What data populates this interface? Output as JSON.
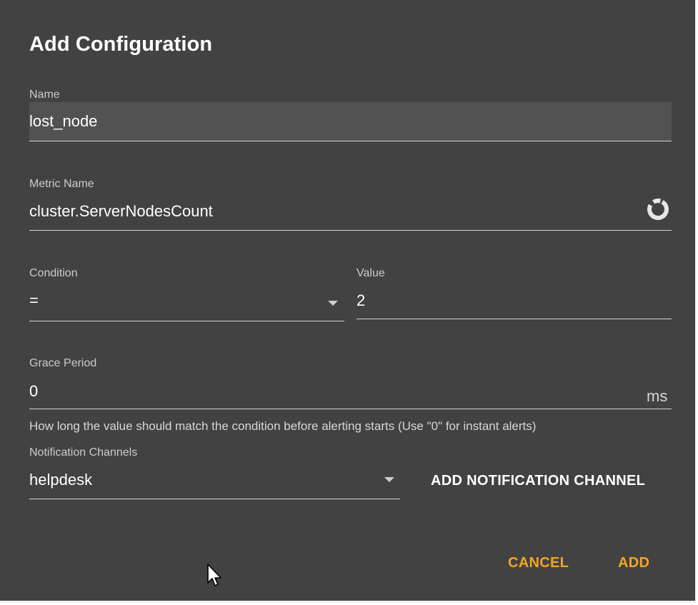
{
  "dialog": {
    "title": "Add Configuration"
  },
  "fields": {
    "name": {
      "label": "Name",
      "value": "lost_node"
    },
    "metric_name": {
      "label": "Metric Name",
      "value": "cluster.ServerNodesCount"
    },
    "condition": {
      "label": "Condition",
      "value": "="
    },
    "value": {
      "label": "Value",
      "value": "2"
    },
    "grace_period": {
      "label": "Grace Period",
      "value": "0",
      "suffix": "ms",
      "helper": "How long the value should match the condition before alerting starts (Use \"0\" for instant alerts)"
    },
    "notification_channels": {
      "label": "Notification Channels",
      "value": "helpdesk"
    }
  },
  "buttons": {
    "add_channel": "ADD NOTIFICATION CHANNEL",
    "cancel": "CANCEL",
    "add": "ADD"
  },
  "icons": {
    "metric_loading": "loading-spinner-icon",
    "dropdown": "dropdown-arrow-icon",
    "cursor": "mouse-pointer-icon"
  },
  "colors": {
    "dialog_background": "#424242",
    "accent": "#f5a623",
    "filled_field": "#525252",
    "text": "#ffffff"
  }
}
